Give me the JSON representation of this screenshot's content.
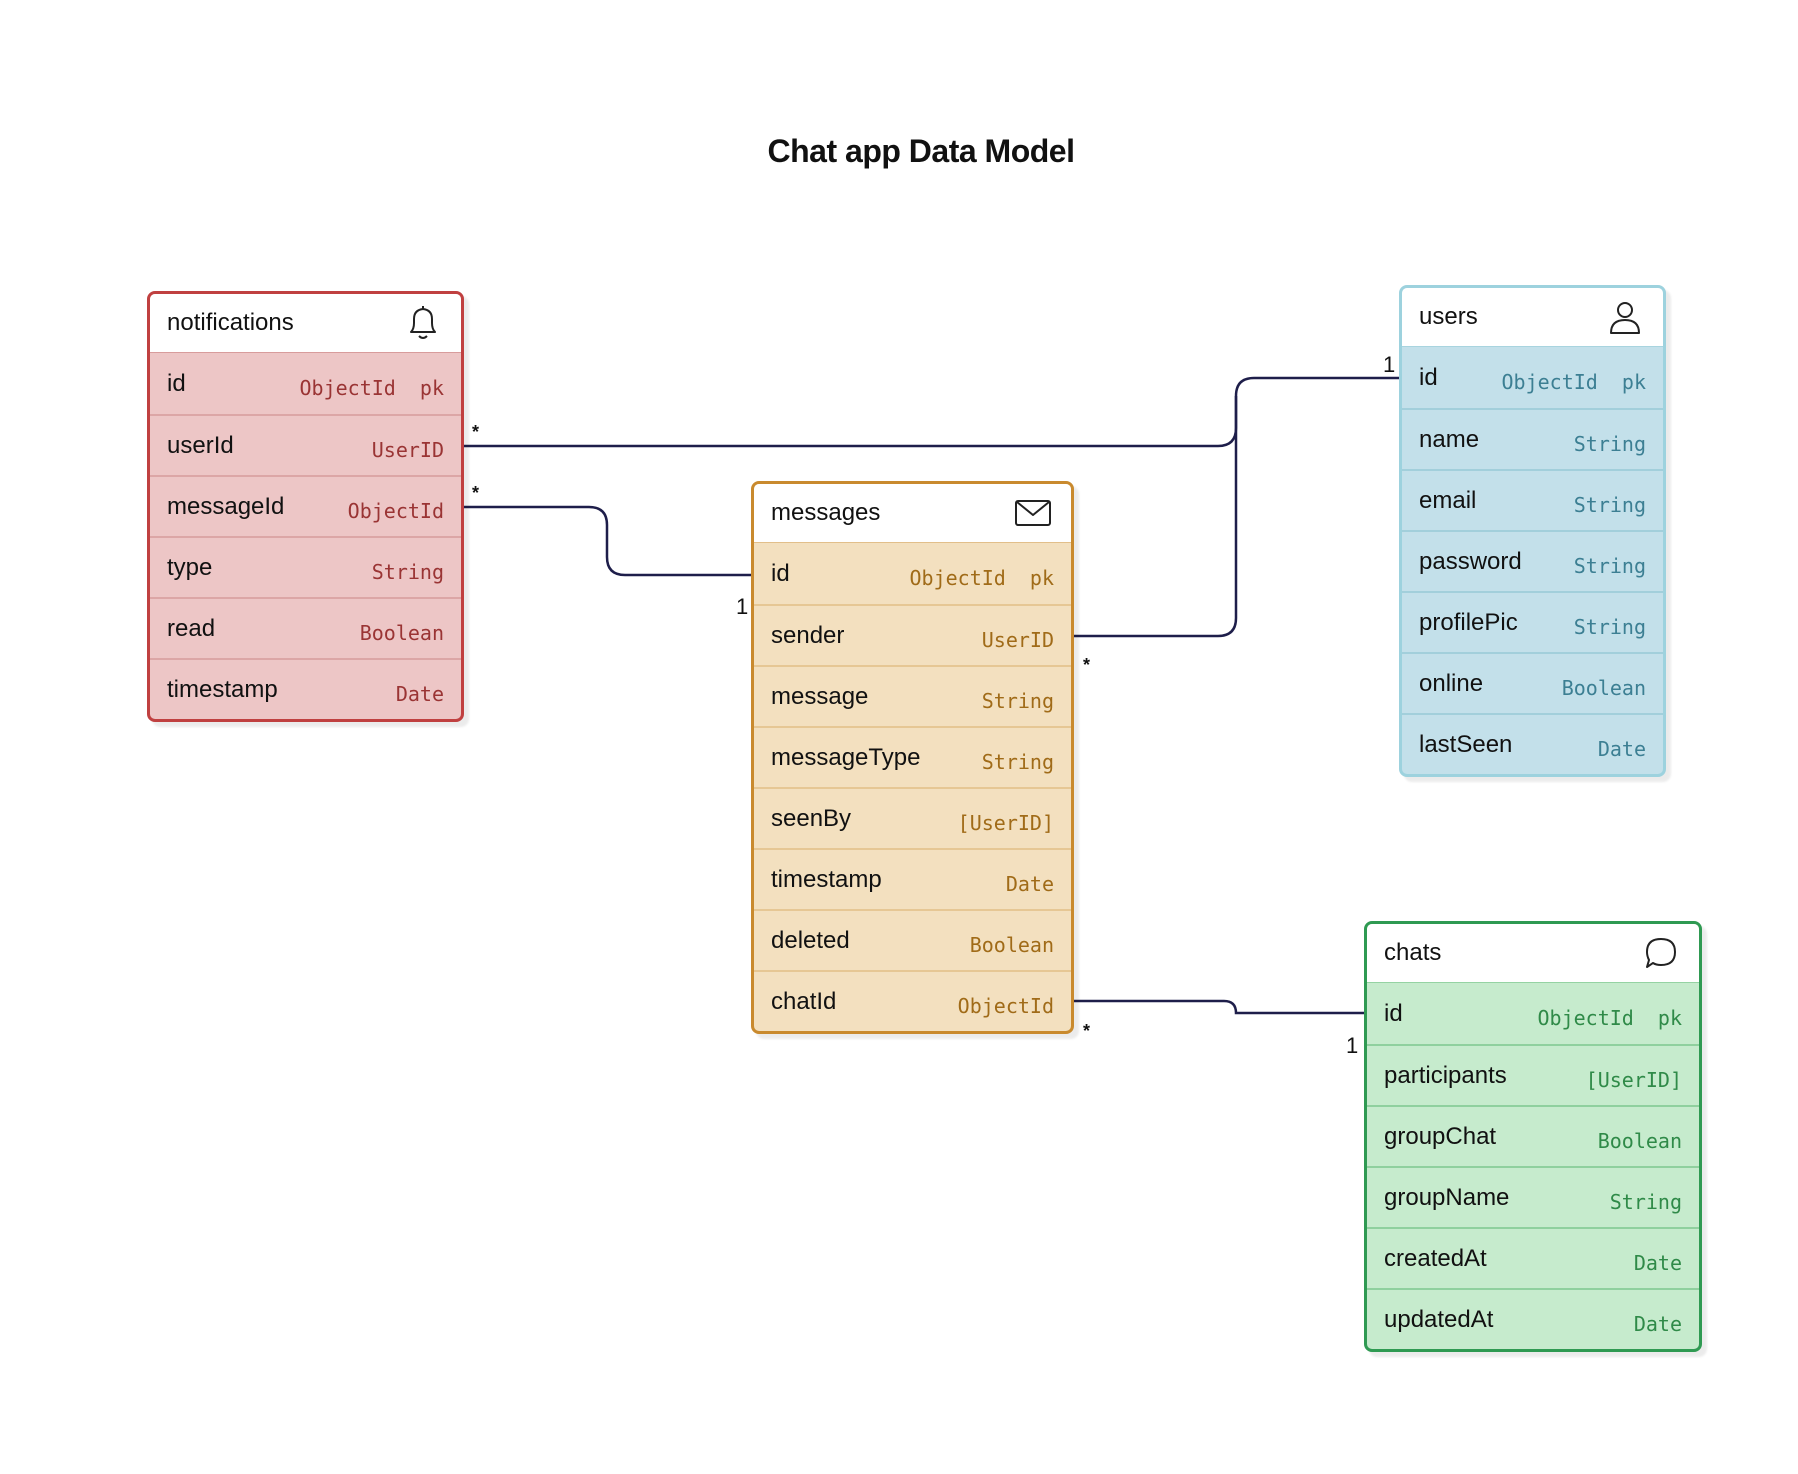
{
  "title": "Chat app Data Model",
  "entities": {
    "notifications": {
      "name": "notifications",
      "icon": "bell-icon",
      "color": "#c04040",
      "fields": [
        {
          "name": "id",
          "type": "ObjectId  pk"
        },
        {
          "name": "userId",
          "type": "UserID"
        },
        {
          "name": "messageId",
          "type": "ObjectId"
        },
        {
          "name": "type",
          "type": "String"
        },
        {
          "name": "read",
          "type": "Boolean"
        },
        {
          "name": "timestamp",
          "type": "Date"
        }
      ]
    },
    "messages": {
      "name": "messages",
      "icon": "mail-icon",
      "color": "#c98a2e",
      "fields": [
        {
          "name": "id",
          "type": "ObjectId  pk"
        },
        {
          "name": "sender",
          "type": "UserID"
        },
        {
          "name": "message",
          "type": "String"
        },
        {
          "name": "messageType",
          "type": "String"
        },
        {
          "name": "seenBy",
          "type": "[UserID]"
        },
        {
          "name": "timestamp",
          "type": "Date"
        },
        {
          "name": "deleted",
          "type": "Boolean"
        },
        {
          "name": "chatId",
          "type": "ObjectId"
        }
      ]
    },
    "users": {
      "name": "users",
      "icon": "user-icon",
      "color": "#9dd2de",
      "fields": [
        {
          "name": "id",
          "type": "ObjectId  pk"
        },
        {
          "name": "name",
          "type": "String"
        },
        {
          "name": "email",
          "type": "String"
        },
        {
          "name": "password",
          "type": "String"
        },
        {
          "name": "profilePic",
          "type": "String"
        },
        {
          "name": "online",
          "type": "Boolean"
        },
        {
          "name": "lastSeen",
          "type": "Date"
        }
      ]
    },
    "chats": {
      "name": "chats",
      "icon": "chat-bubble-icon",
      "color": "#2f9a52",
      "fields": [
        {
          "name": "id",
          "type": "ObjectId  pk"
        },
        {
          "name": "participants",
          "type": "[UserID]"
        },
        {
          "name": "groupChat",
          "type": "Boolean"
        },
        {
          "name": "groupName",
          "type": "String"
        },
        {
          "name": "createdAt",
          "type": "Date"
        },
        {
          "name": "updatedAt",
          "type": "Date"
        }
      ]
    }
  },
  "relationships": [
    {
      "from": "notifications.userId",
      "to": "users.id",
      "from_card": "*",
      "to_card": "1"
    },
    {
      "from": "notifications.messageId",
      "to": "messages.id",
      "from_card": "*",
      "to_card": "1"
    },
    {
      "from": "messages.sender",
      "to": "users.id",
      "from_card": "*",
      "to_card": "1"
    },
    {
      "from": "messages.chatId",
      "to": "chats.id",
      "from_card": "*",
      "to_card": "1"
    }
  ],
  "line_color": "#1e1e4a"
}
